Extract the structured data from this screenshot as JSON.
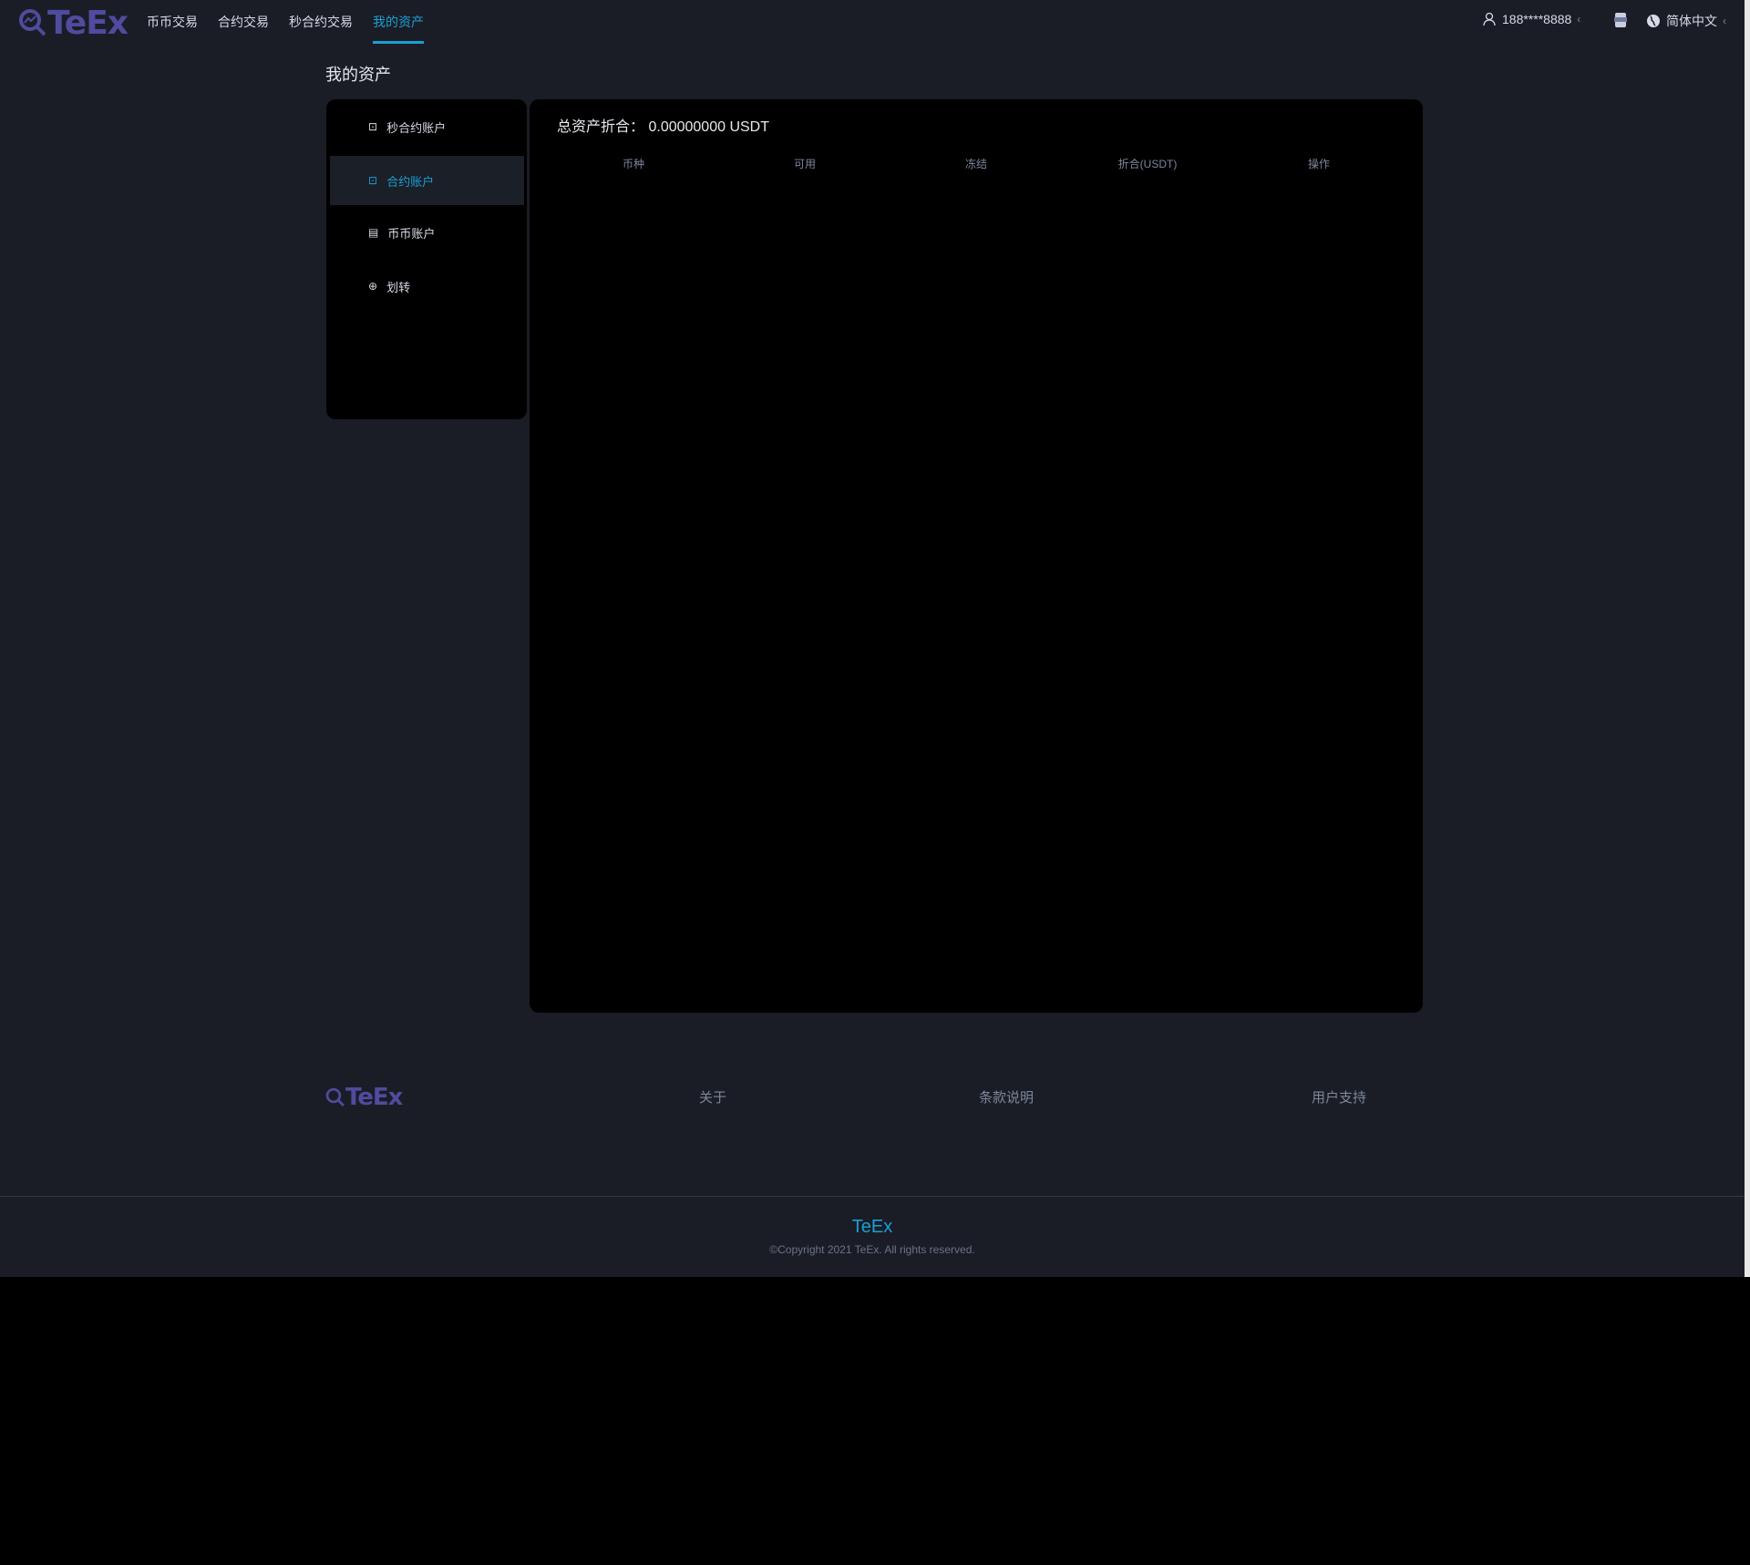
{
  "brand": "TeEx",
  "nav": {
    "items": [
      "币币交易",
      "合约交易",
      "秒合约交易",
      "我的资产"
    ],
    "active": 3,
    "user": "188****8888",
    "language": "简体中文"
  },
  "page_title": "我的资产",
  "sidebar": {
    "items": [
      {
        "label": "秒合约账户",
        "icon": "contract-icon"
      },
      {
        "label": "合约账户",
        "icon": "contract-icon"
      },
      {
        "label": "币币账户",
        "icon": "coins-icon"
      },
      {
        "label": "划转",
        "icon": "transfer-icon"
      }
    ],
    "active": 1
  },
  "main": {
    "total_label": "总资产折合：",
    "total_value": "0.00000000 USDT",
    "columns": [
      "币种",
      "可用",
      "冻结",
      "折合(USDT)",
      "操作"
    ]
  },
  "footer": {
    "links": [
      "关于",
      "条款说明",
      "用户支持"
    ],
    "brand": "TeEx",
    "copyright": "©Copyright 2021 TeEx. All rights reserved."
  },
  "colors": {
    "accent": "#1a9fd6",
    "logo": "#4f4b9e",
    "background": "#1a1d25",
    "panel": "#000000"
  }
}
